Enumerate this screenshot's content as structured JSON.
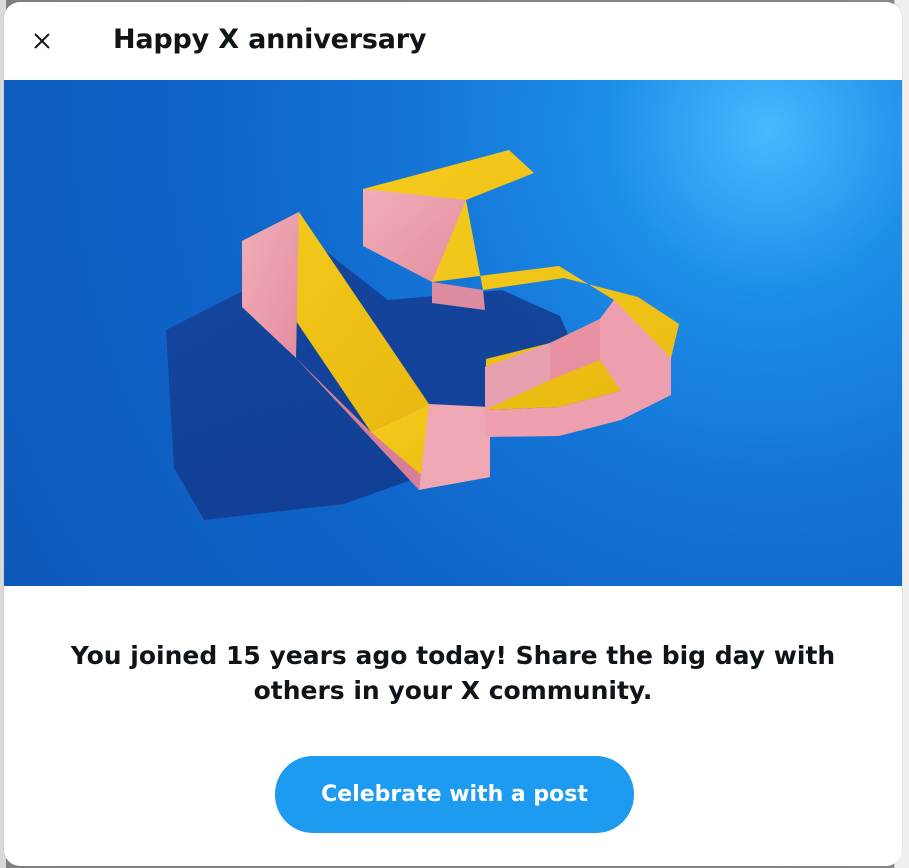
{
  "dialog": {
    "title": "Happy X anniversary",
    "message": "You joined 15 years ago today! Share the big day with others in your X community.",
    "celebrate_label": "Celebrate with a post"
  },
  "hero": {
    "alt": "15"
  },
  "colors": {
    "accent": "#1d9bf0",
    "text": "#0f1419",
    "hero_blue": "#1576d8",
    "number_yellow": "#f2c314",
    "number_pink": "#e79aa9"
  },
  "icons": {
    "close": "close-icon"
  }
}
